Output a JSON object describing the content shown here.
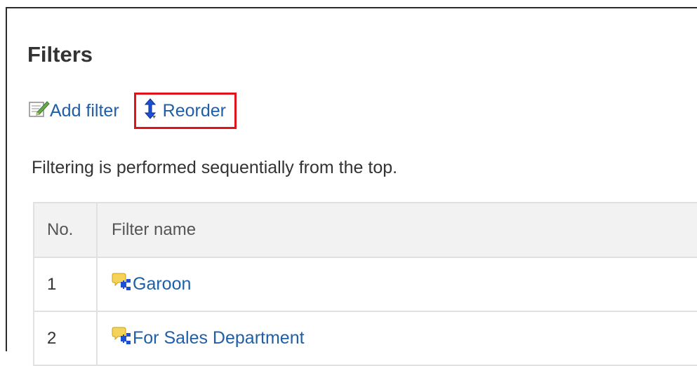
{
  "page": {
    "title": "Filters",
    "note": "Filtering is performed sequentially from the top."
  },
  "toolbar": {
    "add_filter_label": "Add filter",
    "add_filter_icon": "edit-note-icon",
    "reorder_label": "Reorder",
    "reorder_icon": "reorder-arrows-icon",
    "highlight_color": "#e2121b"
  },
  "table": {
    "columns": [
      "No.",
      "Filter name"
    ],
    "rows": [
      {
        "no": "1",
        "name": "Garoon",
        "icon": "filter-rule-icon"
      },
      {
        "no": "2",
        "name": "For Sales Department",
        "icon": "filter-rule-icon"
      }
    ]
  },
  "colors": {
    "link": "#1f5fa8",
    "text": "#333333",
    "header_bg": "#f2f2f2"
  }
}
